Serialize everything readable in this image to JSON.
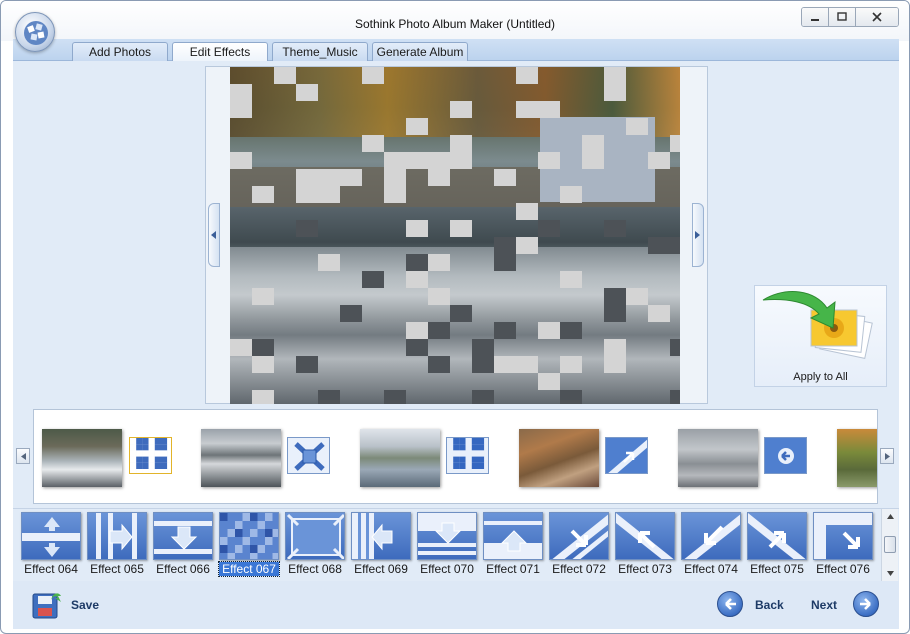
{
  "window": {
    "title": "Sothink Photo Album Maker (Untitled)",
    "controls": {
      "minimize": "minimize-icon",
      "maximize": "maximize-icon",
      "close": "close-icon"
    }
  },
  "tabs": [
    {
      "label": "Add Photos"
    },
    {
      "label": "Edit Effects"
    },
    {
      "label": "Theme_Music"
    },
    {
      "label": "Generate Album"
    }
  ],
  "preview": {
    "prev_icon": "chevron-left-icon",
    "next_icon": "chevron-right-icon"
  },
  "apply_all": {
    "label": "Apply to All"
  },
  "filmstrip": {
    "scroll_left_icon": "chevron-left-icon",
    "scroll_right_icon": "chevron-right-icon"
  },
  "effects": {
    "selected": "Effect 067",
    "items": [
      "Effect 064",
      "Effect 065",
      "Effect 066",
      "Effect 067",
      "Effect 068",
      "Effect 069",
      "Effect 070",
      "Effect 071",
      "Effect 072",
      "Effect 073",
      "Effect 074",
      "Effect 075",
      "Effect 076"
    ]
  },
  "footer": {
    "save_label": "Save",
    "back_label": "Back",
    "next_label": "Next"
  },
  "colors": {
    "accent": "#3e6bbd",
    "panel": "#e1ebf7",
    "tabbar": "#bcd3ee",
    "selection": "#3a77d6"
  }
}
